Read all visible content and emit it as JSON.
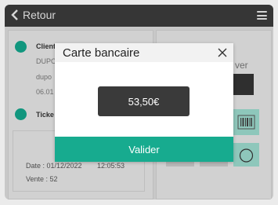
{
  "header": {
    "back_label": "Retour"
  },
  "client": {
    "title": "Client",
    "line1": "DUPO",
    "line2": "dupo",
    "line3": "06.01"
  },
  "ticket": {
    "title": "Ticke",
    "date": "Date : 01/12/2022",
    "time": "12:05:53",
    "sale": "Vente : 52"
  },
  "right_panel": {
    "partial_label": "ver"
  },
  "modal": {
    "title": "Carte bancaire",
    "amount": "53,50€",
    "validate_label": "Valider"
  },
  "colors": {
    "accent": "#17ab8f",
    "topbar": "#3b3b3b",
    "amount_bg": "#3a3a3a"
  }
}
